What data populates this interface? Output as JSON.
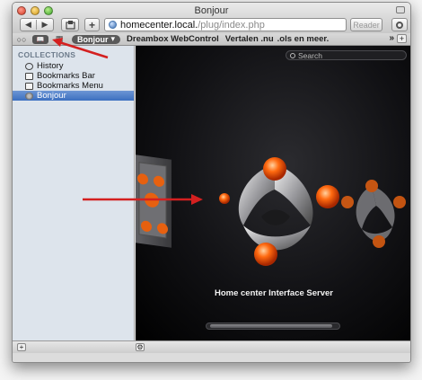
{
  "window": {
    "title": "Bonjour"
  },
  "toolbar": {
    "back": "◀",
    "forward": "▶",
    "add": "+",
    "url_host": "homecenter.local.",
    "url_path": "/plug/index.php",
    "reload_label": "Reader"
  },
  "bookmarks_bar": {
    "readinglist_glyph": "○○",
    "bookmarks_toggle_glyph": "📖",
    "topsites_glyph": "▦",
    "pill_label": "Bonjour",
    "links": [
      "Dreambox WebControl",
      "Vertalen .nu",
      ".ols en meer."
    ],
    "more_glyph": "»",
    "plus_glyph": "+"
  },
  "sidebar": {
    "heading": "COLLECTIONS",
    "items": [
      {
        "label": "History",
        "icon": "clock-icon",
        "selected": false
      },
      {
        "label": "Bookmarks Bar",
        "icon": "book-icon",
        "selected": false
      },
      {
        "label": "Bookmarks Menu",
        "icon": "book-icon",
        "selected": false
      },
      {
        "label": "Bonjour",
        "icon": "bonjour-icon",
        "selected": true
      }
    ]
  },
  "coverflow": {
    "search_placeholder": "Search",
    "caption": "Home center Interface Server"
  },
  "bottom_bar": {
    "add_glyph": "+",
    "action_glyph": "⚙"
  },
  "colors": {
    "annotation_red": "#d42020",
    "orb_orange": "#ff6a10",
    "selection_blue": "#3c6fc0"
  }
}
